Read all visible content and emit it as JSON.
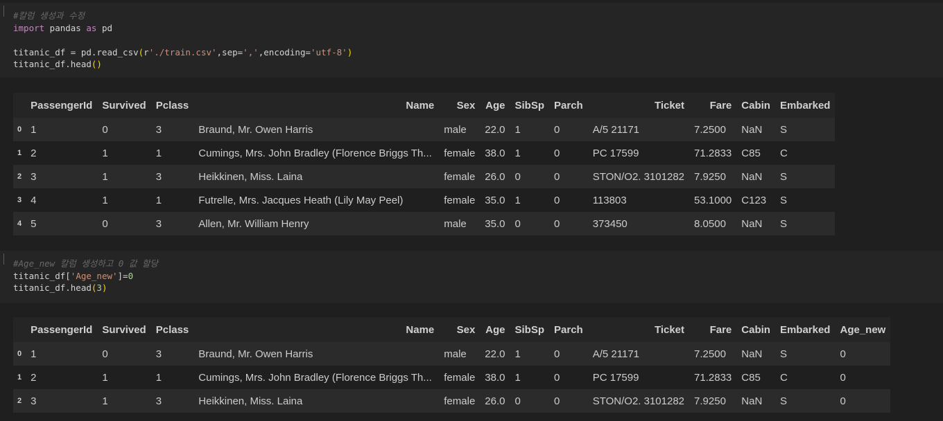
{
  "cell1": {
    "code": [
      [
        {
          "t": "#칼럼 생성과 수정",
          "c": "comment"
        }
      ],
      [
        {
          "t": "import",
          "c": "kw"
        },
        {
          "t": " pandas ",
          "c": ""
        },
        {
          "t": "as",
          "c": "kw"
        },
        {
          "t": " pd",
          "c": ""
        }
      ],
      [],
      [
        {
          "t": "titanic_df = pd.read_csv",
          "c": ""
        },
        {
          "t": "(",
          "c": "paren"
        },
        {
          "t": "r",
          "c": ""
        },
        {
          "t": "'./train.csv'",
          "c": "str"
        },
        {
          "t": ",sep=",
          "c": ""
        },
        {
          "t": "','",
          "c": "str"
        },
        {
          "t": ",encoding=",
          "c": ""
        },
        {
          "t": "'utf-8'",
          "c": "str"
        },
        {
          "t": ")",
          "c": "paren"
        }
      ],
      [
        {
          "t": "titanic_df.head",
          "c": ""
        },
        {
          "t": "()",
          "c": "paren"
        }
      ]
    ]
  },
  "table1": {
    "columns": [
      "",
      "PassengerId",
      "Survived",
      "Pclass",
      "Name",
      "Sex",
      "Age",
      "SibSp",
      "Parch",
      "Ticket",
      "Fare",
      "Cabin",
      "Embarked"
    ],
    "rows": [
      [
        "0",
        "1",
        "0",
        "3",
        "Braund, Mr. Owen Harris",
        "male",
        "22.0",
        "1",
        "0",
        "A/5 21171",
        "7.2500",
        "NaN",
        "S"
      ],
      [
        "1",
        "2",
        "1",
        "1",
        "Cumings, Mrs. John Bradley (Florence Briggs Th...",
        "female",
        "38.0",
        "1",
        "0",
        "PC 17599",
        "71.2833",
        "C85",
        "C"
      ],
      [
        "2",
        "3",
        "1",
        "3",
        "Heikkinen, Miss. Laina",
        "female",
        "26.0",
        "0",
        "0",
        "STON/O2. 3101282",
        "7.9250",
        "NaN",
        "S"
      ],
      [
        "3",
        "4",
        "1",
        "1",
        "Futrelle, Mrs. Jacques Heath (Lily May Peel)",
        "female",
        "35.0",
        "1",
        "0",
        "113803",
        "53.1000",
        "C123",
        "S"
      ],
      [
        "4",
        "5",
        "0",
        "3",
        "Allen, Mr. William Henry",
        "male",
        "35.0",
        "0",
        "0",
        "373450",
        "8.0500",
        "NaN",
        "S"
      ]
    ]
  },
  "cell2": {
    "code": [
      [
        {
          "t": "#Age_new 칼럼 생성하고 0 값 할당",
          "c": "comment"
        }
      ],
      [
        {
          "t": "titanic_df[",
          "c": ""
        },
        {
          "t": "'Age_new'",
          "c": "str"
        },
        {
          "t": "]=",
          "c": ""
        },
        {
          "t": "0",
          "c": "num"
        }
      ],
      [
        {
          "t": "titanic_df.head",
          "c": ""
        },
        {
          "t": "(",
          "c": "paren"
        },
        {
          "t": "3",
          "c": "num"
        },
        {
          "t": ")",
          "c": "paren"
        }
      ]
    ]
  },
  "table2": {
    "columns": [
      "",
      "PassengerId",
      "Survived",
      "Pclass",
      "Name",
      "Sex",
      "Age",
      "SibSp",
      "Parch",
      "Ticket",
      "Fare",
      "Cabin",
      "Embarked",
      "Age_new"
    ],
    "rows": [
      [
        "0",
        "1",
        "0",
        "3",
        "Braund, Mr. Owen Harris",
        "male",
        "22.0",
        "1",
        "0",
        "A/5 21171",
        "7.2500",
        "NaN",
        "S",
        "0"
      ],
      [
        "1",
        "2",
        "1",
        "1",
        "Cumings, Mrs. John Bradley (Florence Briggs Th...",
        "female",
        "38.0",
        "1",
        "0",
        "PC 17599",
        "71.2833",
        "C85",
        "C",
        "0"
      ],
      [
        "2",
        "3",
        "1",
        "3",
        "Heikkinen, Miss. Laina",
        "female",
        "26.0",
        "0",
        "0",
        "STON/O2. 3101282",
        "7.9250",
        "NaN",
        "S",
        "0"
      ]
    ]
  }
}
